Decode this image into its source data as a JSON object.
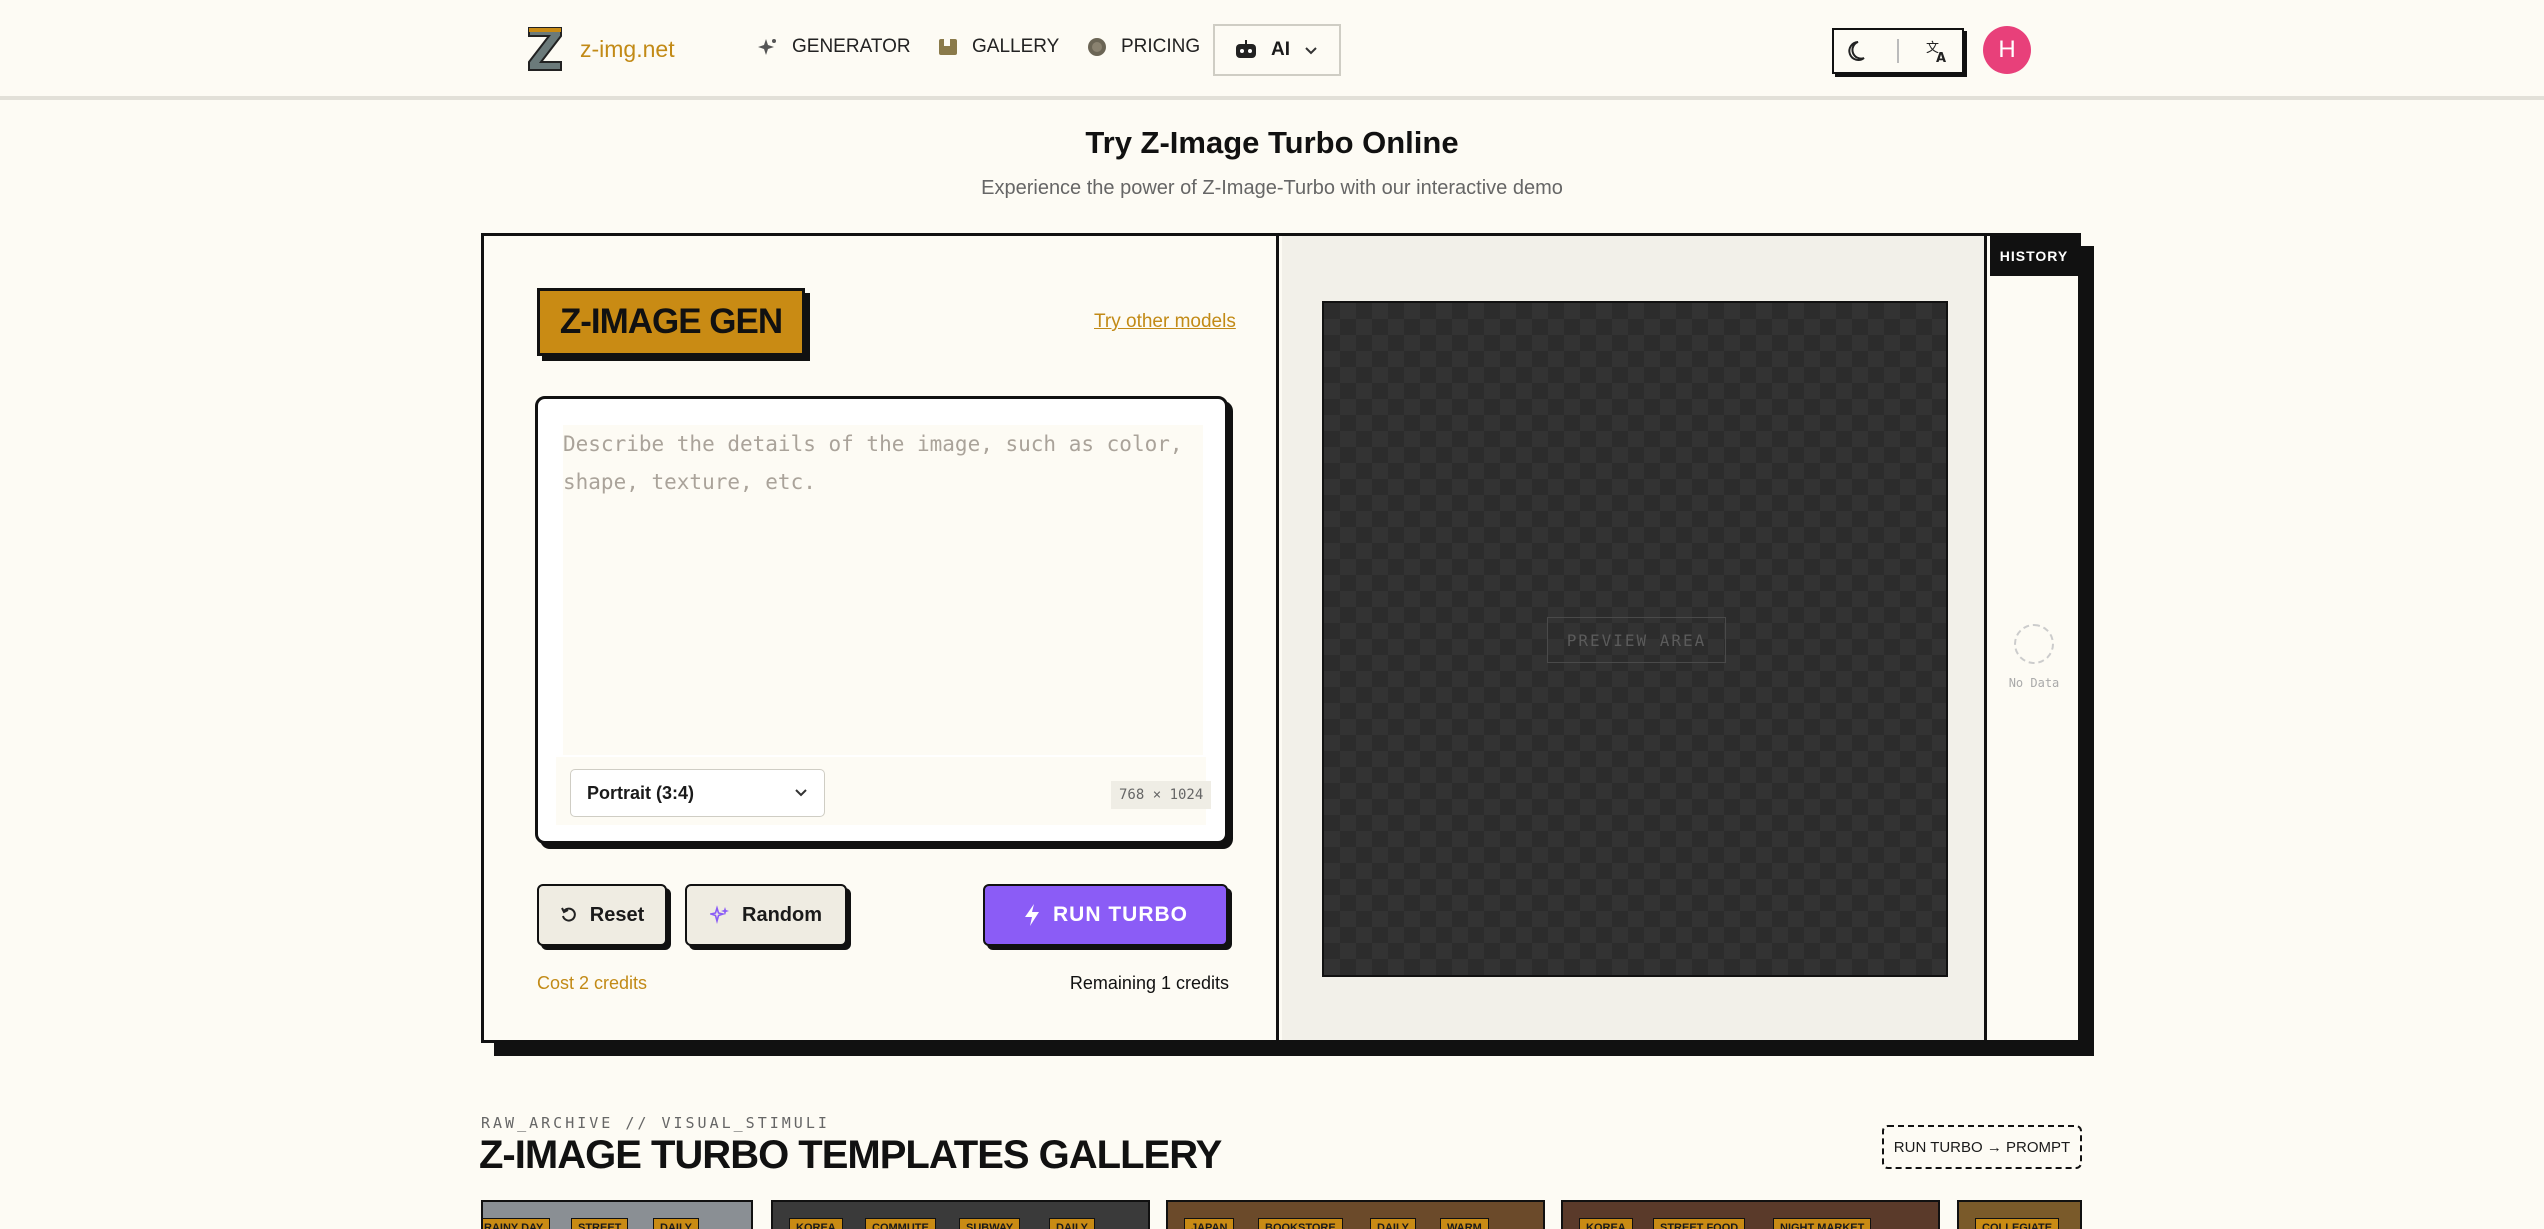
{
  "nav": {
    "brand": "z-img.net",
    "links": [
      {
        "label": "GENERATOR",
        "icon": "sparkle-icon"
      },
      {
        "label": "GALLERY",
        "icon": "image-album-icon"
      },
      {
        "label": "PRICING",
        "icon": "coin-icon"
      }
    ],
    "ai_label": "AI",
    "avatar_letter": "H"
  },
  "hero": {
    "title": "Try Z-Image Turbo Online",
    "subtitle": "Experience the power of Z-Image-Turbo with our interactive demo"
  },
  "generator": {
    "badge": "Z-IMAGE GEN",
    "try_other": "Try other models",
    "prompt_placeholder": "Describe the details of the image, such as color, shape, texture, etc.",
    "ratio": "Portrait (3:4)",
    "dimensions": "768 × 1024",
    "reset_label": "Reset",
    "random_label": "Random",
    "run_label": "RUN TURBO",
    "cost": "Cost 2 credits",
    "remaining": "Remaining 1 credits"
  },
  "preview": {
    "label": "PREVIEW AREA"
  },
  "history": {
    "title": "HISTORY",
    "empty": "No Data"
  },
  "gallery": {
    "kicker": "RAW_ARCHIVE // VISUAL_STIMULI",
    "title": "Z-IMAGE TURBO TEMPLATES GALLERY",
    "button": "RUN TURBO → PROMPT",
    "thumbs": [
      {
        "tags": [
          "RAINY DAY",
          "STREET",
          "DAILY"
        ]
      },
      {
        "tags": [
          "KOREA",
          "COMMUTE",
          "SUBWAY",
          "DAILY"
        ]
      },
      {
        "tags": [
          "JAPAN",
          "BOOKSTORE",
          "DAILY",
          "WARM"
        ]
      },
      {
        "tags": [
          "KOREA",
          "STREET FOOD",
          "NIGHT MARKET"
        ]
      },
      {
        "tags": [
          "COLLEGIATE"
        ]
      }
    ]
  },
  "colors": {
    "accent": "#c98b14",
    "run": "#8b5cf6",
    "avatar": "#e8407a",
    "background": "#fdfbf4"
  }
}
